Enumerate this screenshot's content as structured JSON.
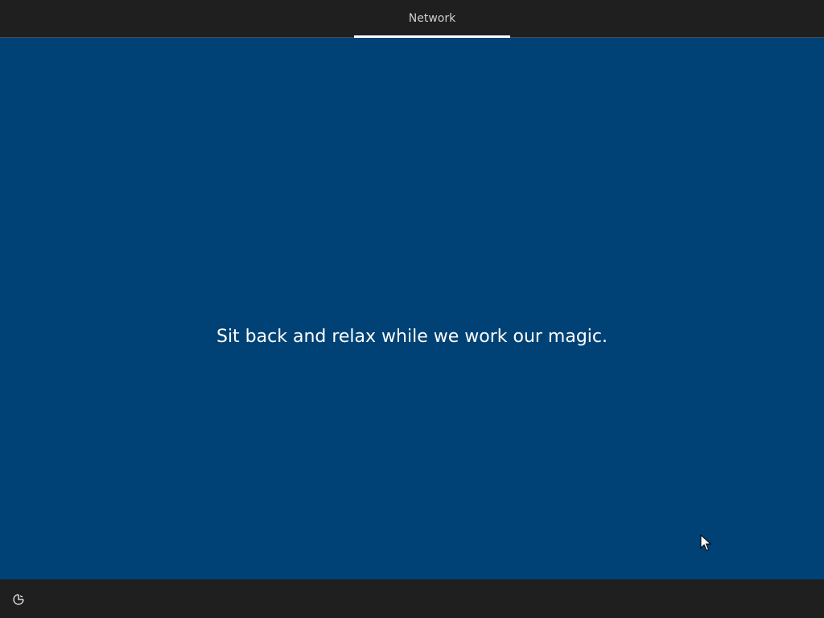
{
  "header": {
    "tab_label": "Network"
  },
  "main": {
    "message": "Sit back and relax while we work our magic."
  },
  "footer": {
    "icon": "accessibility-icon"
  },
  "colors": {
    "background": "#004275",
    "bars": "#1f1f1f",
    "text": "#ffffff",
    "tab_text": "#cfcfcf"
  }
}
